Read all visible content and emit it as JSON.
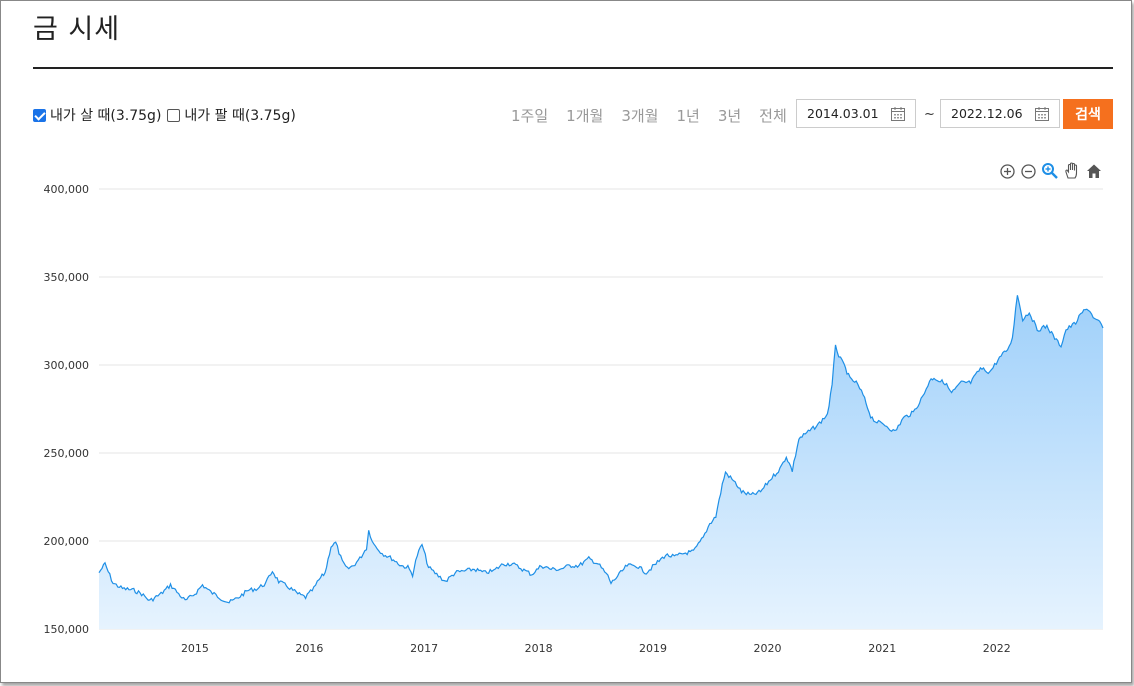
{
  "page": {
    "title": "금 시세"
  },
  "options": [
    {
      "label": "내가 살 때(3.75g)",
      "checked": true
    },
    {
      "label": "내가 팔 때(3.75g)",
      "checked": false
    }
  ],
  "periods": [
    "1주일",
    "1개월",
    "3개월",
    "1년",
    "3년",
    "전체"
  ],
  "date_range": {
    "start": "2014.03.01",
    "separator": "~",
    "end": "2022.12.06"
  },
  "search_label": "검색",
  "toolbar_icons": [
    "zoom-in-icon",
    "zoom-out-icon",
    "magnify-icon",
    "pan-hand-icon",
    "home-icon"
  ],
  "colors": {
    "line": "#1e8fe6",
    "fill_top": "#9fd0fa",
    "fill_bottom": "#e6f3fe",
    "accent": "#f5701e",
    "checkbox": "#1a73e8"
  },
  "chart_data": {
    "type": "area",
    "title": "",
    "xlabel": "",
    "ylabel": "",
    "x_range": [
      "2014-03-01",
      "2022-12-06"
    ],
    "ylim": [
      150000,
      400000
    ],
    "y_ticks": [
      {
        "value": 150000,
        "label": "150,000"
      },
      {
        "value": 200000,
        "label": "200,000"
      },
      {
        "value": 250000,
        "label": "250,000"
      },
      {
        "value": 300000,
        "label": "300,000"
      },
      {
        "value": 350000,
        "label": "350,000"
      },
      {
        "value": 400000,
        "label": "400,000"
      }
    ],
    "x_ticks": [
      {
        "date": "2015-01-01",
        "label": "2015"
      },
      {
        "date": "2016-01-01",
        "label": "2016"
      },
      {
        "date": "2017-01-01",
        "label": "2017"
      },
      {
        "date": "2018-01-01",
        "label": "2018"
      },
      {
        "date": "2019-01-01",
        "label": "2019"
      },
      {
        "date": "2020-01-01",
        "label": "2020"
      },
      {
        "date": "2021-01-01",
        "label": "2021"
      },
      {
        "date": "2022-01-01",
        "label": "2022"
      }
    ],
    "grid": true,
    "series": [
      {
        "points": [
          [
            "2014-03-01",
            182000
          ],
          [
            "2014-03-20",
            187000
          ],
          [
            "2014-04-15",
            176000
          ],
          [
            "2014-05-15",
            173000
          ],
          [
            "2014-06-20",
            172000
          ],
          [
            "2014-07-15",
            170000
          ],
          [
            "2014-08-10",
            166000
          ],
          [
            "2014-09-15",
            170000
          ],
          [
            "2014-10-15",
            175000
          ],
          [
            "2014-11-10",
            170000
          ],
          [
            "2014-12-01",
            166000
          ],
          [
            "2015-01-01",
            170000
          ],
          [
            "2015-01-25",
            175000
          ],
          [
            "2015-02-20",
            171000
          ],
          [
            "2015-03-20",
            168000
          ],
          [
            "2015-04-20",
            165000
          ],
          [
            "2015-05-20",
            168000
          ],
          [
            "2015-06-20",
            172000
          ],
          [
            "2015-07-20",
            173000
          ],
          [
            "2015-08-15",
            176000
          ],
          [
            "2015-09-05",
            183000
          ],
          [
            "2015-09-25",
            177000
          ],
          [
            "2015-10-25",
            174000
          ],
          [
            "2015-11-25",
            170000
          ],
          [
            "2015-12-20",
            168000
          ],
          [
            "2016-01-15",
            173000
          ],
          [
            "2016-02-01",
            178000
          ],
          [
            "2016-02-20",
            182000
          ],
          [
            "2016-03-10",
            197000
          ],
          [
            "2016-03-25",
            199000
          ],
          [
            "2016-04-15",
            188000
          ],
          [
            "2016-05-01",
            184000
          ],
          [
            "2016-05-20",
            186000
          ],
          [
            "2016-06-10",
            190000
          ],
          [
            "2016-07-01",
            196000
          ],
          [
            "2016-07-08",
            206000
          ],
          [
            "2016-07-25",
            198000
          ],
          [
            "2016-08-20",
            193000
          ],
          [
            "2016-09-20",
            190000
          ],
          [
            "2016-10-20",
            186000
          ],
          [
            "2016-11-10",
            185000
          ],
          [
            "2016-11-25",
            181000
          ],
          [
            "2016-12-10",
            192000
          ],
          [
            "2016-12-25",
            198000
          ],
          [
            "2017-01-15",
            185000
          ],
          [
            "2017-02-10",
            181000
          ],
          [
            "2017-03-10",
            177000
          ],
          [
            "2017-04-10",
            182000
          ],
          [
            "2017-05-10",
            183000
          ],
          [
            "2017-06-10",
            184000
          ],
          [
            "2017-07-10",
            182000
          ],
          [
            "2017-08-10",
            183000
          ],
          [
            "2017-09-10",
            187000
          ],
          [
            "2017-10-10",
            187000
          ],
          [
            "2017-11-10",
            184000
          ],
          [
            "2017-12-10",
            181000
          ],
          [
            "2018-01-10",
            186000
          ],
          [
            "2018-02-10",
            184000
          ],
          [
            "2018-03-10",
            184000
          ],
          [
            "2018-04-10",
            186000
          ],
          [
            "2018-05-10",
            186000
          ],
          [
            "2018-06-10",
            190000
          ],
          [
            "2018-07-10",
            187000
          ],
          [
            "2018-08-10",
            180000
          ],
          [
            "2018-08-20",
            176000
          ],
          [
            "2018-09-10",
            180000
          ],
          [
            "2018-10-10",
            186000
          ],
          [
            "2018-11-10",
            186000
          ],
          [
            "2018-12-10",
            182000
          ],
          [
            "2019-01-10",
            187000
          ],
          [
            "2019-02-10",
            192000
          ],
          [
            "2019-03-10",
            191000
          ],
          [
            "2019-04-10",
            193000
          ],
          [
            "2019-05-10",
            194000
          ],
          [
            "2019-06-10",
            202000
          ],
          [
            "2019-07-01",
            210000
          ],
          [
            "2019-07-20",
            214000
          ],
          [
            "2019-08-10",
            232000
          ],
          [
            "2019-08-20",
            239000
          ],
          [
            "2019-09-10",
            235000
          ],
          [
            "2019-09-25",
            232000
          ],
          [
            "2019-10-10",
            228000
          ],
          [
            "2019-11-10",
            226000
          ],
          [
            "2019-12-10",
            228000
          ],
          [
            "2020-01-10",
            235000
          ],
          [
            "2020-02-10",
            241000
          ],
          [
            "2020-03-01",
            248000
          ],
          [
            "2020-03-20",
            240000
          ],
          [
            "2020-04-10",
            258000
          ],
          [
            "2020-05-10",
            262000
          ],
          [
            "2020-06-10",
            266000
          ],
          [
            "2020-07-10",
            272000
          ],
          [
            "2020-07-25",
            288000
          ],
          [
            "2020-08-05",
            312000
          ],
          [
            "2020-08-15",
            305000
          ],
          [
            "2020-09-01",
            300000
          ],
          [
            "2020-09-20",
            292000
          ],
          [
            "2020-10-10",
            290000
          ],
          [
            "2020-11-01",
            283000
          ],
          [
            "2020-11-25",
            271000
          ],
          [
            "2020-12-10",
            268000
          ],
          [
            "2021-01-10",
            266000
          ],
          [
            "2021-02-10",
            262000
          ],
          [
            "2021-03-10",
            270000
          ],
          [
            "2021-04-10",
            273000
          ],
          [
            "2021-05-10",
            282000
          ],
          [
            "2021-06-01",
            291000
          ],
          [
            "2021-06-15",
            293000
          ],
          [
            "2021-07-01",
            291000
          ],
          [
            "2021-07-20",
            290000
          ],
          [
            "2021-08-10",
            284000
          ],
          [
            "2021-09-10",
            290000
          ],
          [
            "2021-10-10",
            290000
          ],
          [
            "2021-11-10",
            298000
          ],
          [
            "2021-12-10",
            296000
          ],
          [
            "2022-01-10",
            304000
          ],
          [
            "2022-02-10",
            310000
          ],
          [
            "2022-02-20",
            316000
          ],
          [
            "2022-03-08",
            340000
          ],
          [
            "2022-03-25",
            326000
          ],
          [
            "2022-04-15",
            330000
          ],
          [
            "2022-05-10",
            320000
          ],
          [
            "2022-06-10",
            322000
          ],
          [
            "2022-07-10",
            314000
          ],
          [
            "2022-07-25",
            311000
          ],
          [
            "2022-08-10",
            320000
          ],
          [
            "2022-09-10",
            324000
          ],
          [
            "2022-10-01",
            330000
          ],
          [
            "2022-10-20",
            332000
          ],
          [
            "2022-11-10",
            326000
          ],
          [
            "2022-11-25",
            324000
          ],
          [
            "2022-12-06",
            321000
          ]
        ]
      }
    ]
  }
}
